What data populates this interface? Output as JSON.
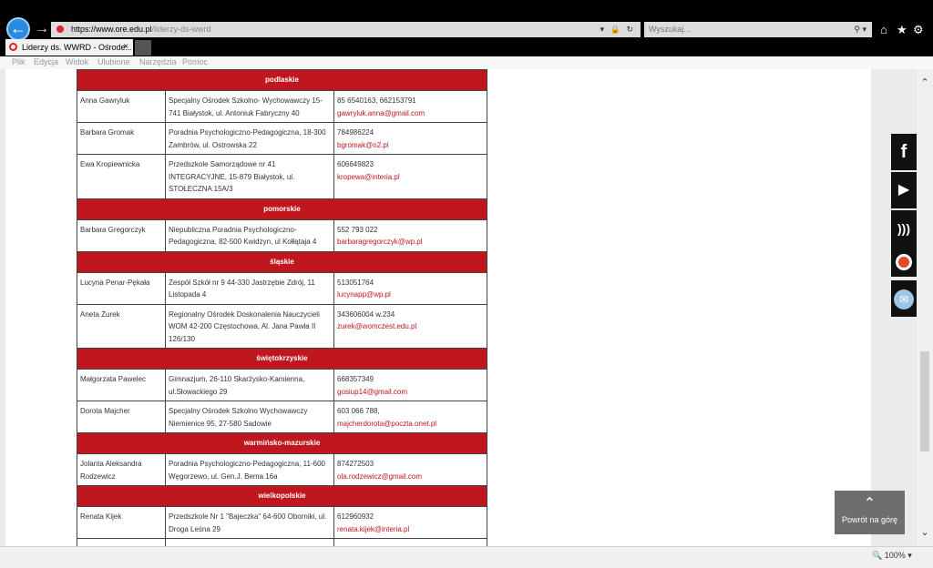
{
  "browser": {
    "url_host": "https://www.ore.edu.pl",
    "url_path": "/liderzy-ds-wwrd",
    "search_placeholder": "Wyszukaj...",
    "tab_title": "Liderzy ds. WWRD - Ośrode...",
    "tab_close": "×",
    "menu": [
      "Plik",
      "Edycja",
      "Widok",
      "Ulubione",
      "Narzędzia",
      "Pomoc"
    ],
    "zoom": "100%"
  },
  "sections": [
    {
      "region": "podlaskie",
      "rows": [
        {
          "name": "Anna Gawryluk",
          "institution": "Specjalny Ośrodek Szkolno- Wychowawczy 15-741 Białystok, ul. Antoniuk Fabryczny 40",
          "phone": "85 6540163, 662153791",
          "email": "gawryluk.anna@gmail.com"
        },
        {
          "name": "Barbara Gromak",
          "institution": "Poradnia Psychologiczno-Pedagogiczna, 18-300 Zambrów, ul. Ostrowska 22",
          "phone": "784986224",
          "email": "bgromak@o2.pl"
        },
        {
          "name": "Ewa Kropiewnicka",
          "institution": "Przedszkole Samorządowe nr 41 INTEGRACYJNE, 15-879 Białystok, ul. STOŁECZNA 15A/3",
          "phone": "606649823",
          "email": "kropewa@interia.pl"
        }
      ]
    },
    {
      "region": "pomorskie",
      "rows": [
        {
          "name": "Barbara Gregorczyk",
          "institution": "Niepubliczna Poradnia Psychologiczno-Pedagogiczna, 82-500 Kwidzyn,  ul Kołłątaja 4",
          "phone": "552 793 022",
          "email": "barbaragregorczyk@wp.pl"
        }
      ]
    },
    {
      "region": "śląskie",
      "rows": [
        {
          "name": "Lucyna  Penar-Pękała",
          "institution": "Zespół Szkół nr 9 44-330 Jastrzębie Zdrój, 11 Listopada 4",
          "phone": "513051764",
          "email": "lucynapp@wp.pl"
        },
        {
          "name": "Aneta  Żurek",
          "institution": "Regionalny Ośrodek Doskonalenia Nauczycieli WOM 42-200 Częstochowa, Al. Jana Pawła II 126/130",
          "phone": "343606004 w.234",
          "email": "zurek@womczest.edu.pl"
        }
      ]
    },
    {
      "region": "świętokrzyskie",
      "rows": [
        {
          "name": "Małgorzata Pawelec",
          "institution": "Gimnazjum, 26-110 Skarżysko-Kamienna, ul.Słowackiego 29",
          "phone": "668357349",
          "email": "gosiup14@gmail.com"
        },
        {
          "name": "Dorota Majcher",
          "institution": "Specjalny Ośrodek Szkolno Wychowawczy Niemienice 95, 27-580 Sadowie",
          "phone": "603 066 788,",
          "email": "majcherdorota@poczta.onet.pl"
        }
      ]
    },
    {
      "region": "warmińsko-mazurskie",
      "rows": [
        {
          "name": "Jolanta Aleksandra Rodzewicz",
          "institution": "Poradnia Psychologiczno-Pedagogiczna, 11-600 Węgorzewo, ul. Gen.J. Bema 16a",
          "phone": "874272503",
          "email": "ola.rodzewicz@gmail.com"
        }
      ]
    },
    {
      "region": "wielkopolskie",
      "rows": [
        {
          "name": "Renata Kijek",
          "institution": "Przedszkole Nr 1 \"Bajeczka\" 64-600 Oborniki, ul. Droga Leśna 29",
          "phone": "612960932",
          "email": "renata.kijek@interia.pl"
        },
        {
          "name": "",
          "institution": "",
          "phone": "",
          "email": ""
        }
      ]
    }
  ],
  "back_to_top": "Powrót na górę",
  "social_icons": [
    "facebook-icon",
    "youtube-play-icon",
    "rss-icon",
    "ore-logo-icon",
    "email-icon"
  ],
  "colors": {
    "accent": "#c0161d",
    "chrome": "#000000",
    "page_bg": "#ebebeb"
  }
}
